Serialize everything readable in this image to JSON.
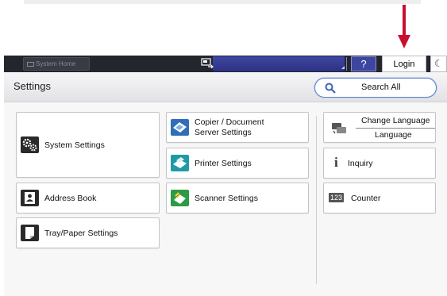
{
  "topbar": {
    "home_label": "System Home",
    "help_label": "?",
    "login_label": "Login",
    "moon_label": "☾"
  },
  "header": {
    "title": "Settings",
    "search_label": "Search All"
  },
  "tiles": {
    "system_settings": "System Settings",
    "copier_line1": "Copier / Document",
    "copier_line2": "Server Settings",
    "printer_settings": "Printer Settings",
    "scanner_settings": "Scanner Settings",
    "address_book": "Address Book",
    "tray_paper": "Tray/Paper Settings",
    "change_language": "Change Language",
    "language": "Language",
    "inquiry": "Inquiry",
    "counter": "Counter",
    "counter_icon_text": "123",
    "inquiry_icon_text": "i"
  },
  "colors": {
    "accent_red": "#c8102e",
    "topbar_bg": "#24262e",
    "status_blue": "#2c3284",
    "search_border": "#5b7fc9"
  }
}
